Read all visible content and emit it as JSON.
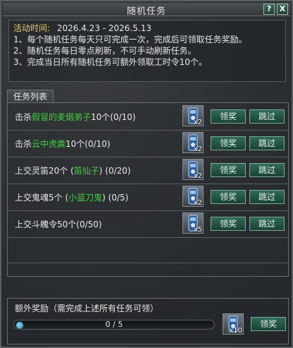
{
  "window": {
    "title": "随机任务",
    "help_label": "?",
    "close_label": "X"
  },
  "info": {
    "time_label": "活动时间:",
    "time_value": "2026.4.23 - 2026.5.13",
    "rules": [
      "1、每个随机任务每天只可完成一次，完成后可领取任务奖励。",
      "2、随机任务每日零点刷新，不可手动刷新任务。",
      "3、完成当日所有随机任务可额外领取工时令10个。"
    ]
  },
  "tabs": [
    {
      "label": "任务列表"
    }
  ],
  "tasks": [
    {
      "prefix": "击杀",
      "highlight": "假冒的麦烟弟子",
      "suffix": "10个(0/10)",
      "reward_count": "x2",
      "claim_label": "领奖",
      "skip_label": "跳过"
    },
    {
      "prefix": "击杀",
      "highlight": "云中虎粪",
      "suffix": "10个(0/10)",
      "reward_count": "x2",
      "claim_label": "领奖",
      "skip_label": "跳过"
    },
    {
      "prefix": "上交灵笛20个 (",
      "highlight": "笛仙子",
      "suffix": ") (0/20)",
      "reward_count": "x2",
      "claim_label": "领奖",
      "skip_label": "跳过"
    },
    {
      "prefix": "上交鬼魂5个 (",
      "highlight": "小蓝刀鬼",
      "suffix": ") (0/5)",
      "reward_count": "x2",
      "claim_label": "领奖",
      "skip_label": "跳过"
    },
    {
      "prefix": "上交斗魄令50个(0/50)",
      "highlight": "",
      "suffix": "",
      "reward_count": "x5",
      "claim_label": "领奖",
      "skip_label": "跳过"
    }
  ],
  "bonus": {
    "title": "额外奖励（需完成上述所有任务可领）",
    "progress_text": "0 / 5",
    "progress_fraction": 0,
    "reward_count": "x10",
    "claim_label": "领奖"
  },
  "colors": {
    "highlight_green": "#3fd13f",
    "label_gold": "#e7c86a",
    "button_green": "#2f6a58"
  }
}
